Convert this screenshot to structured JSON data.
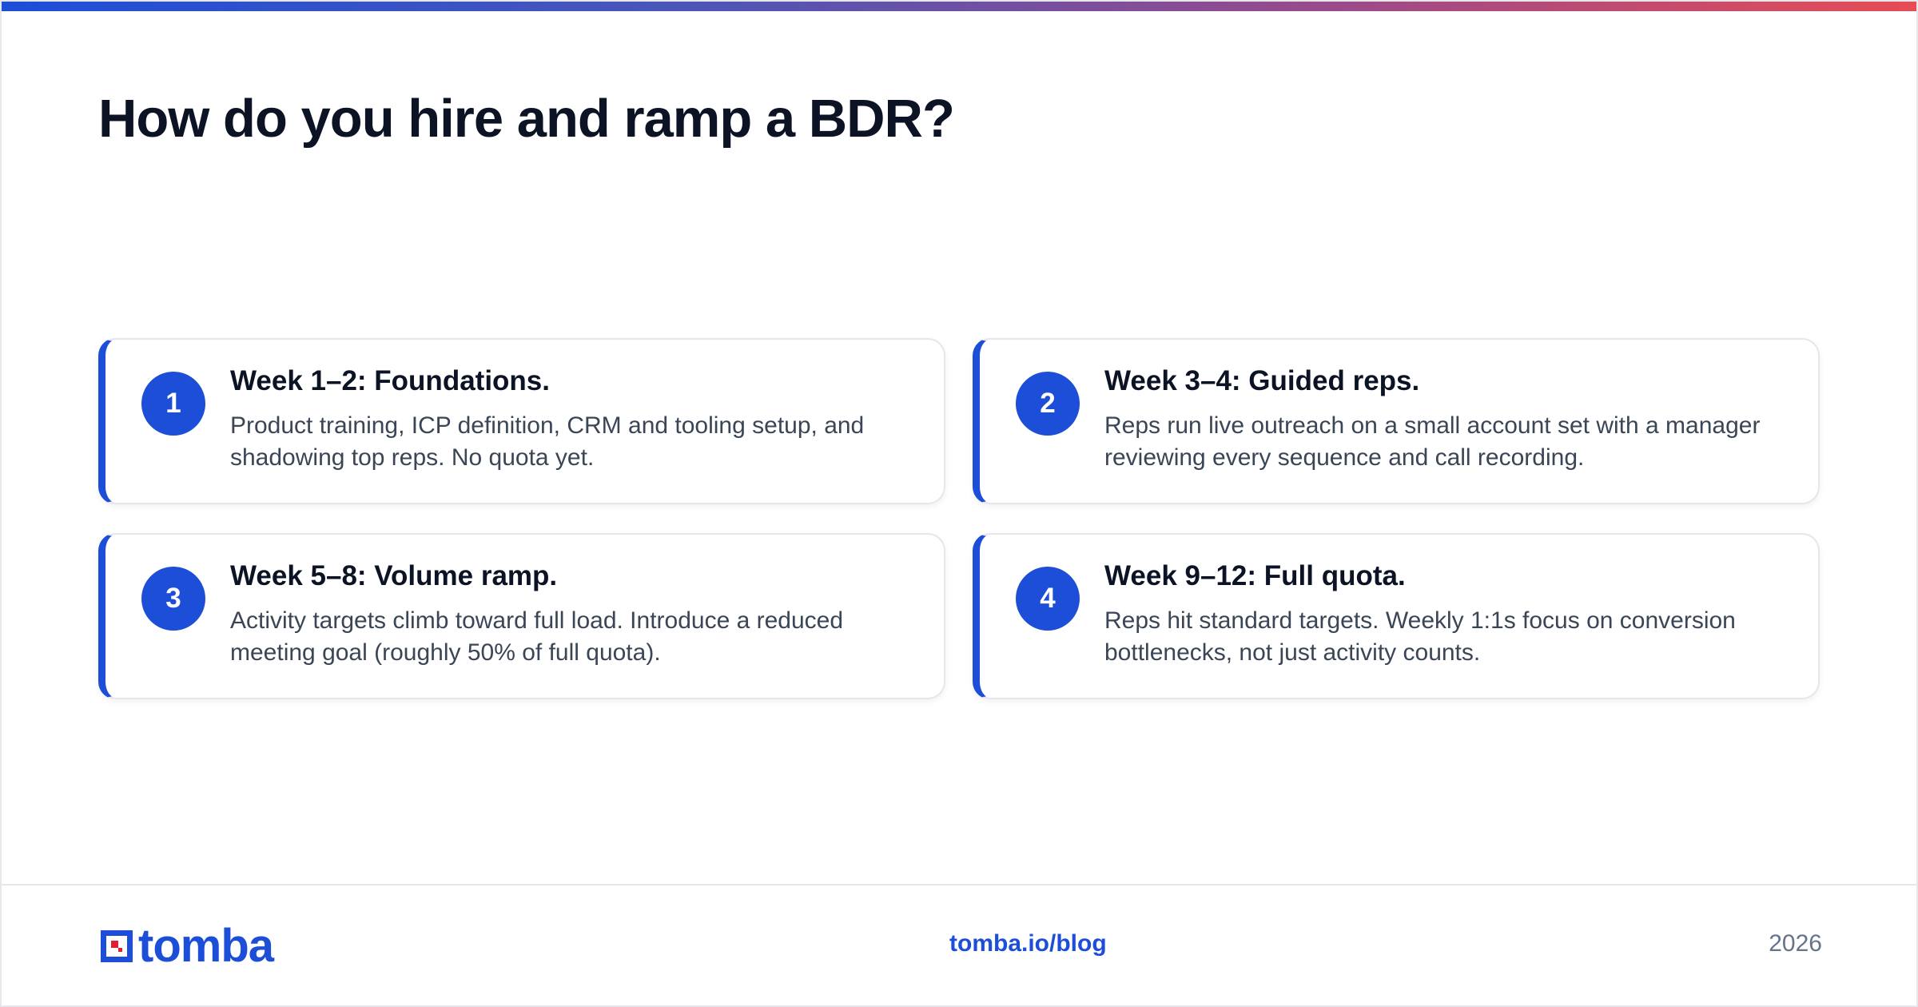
{
  "header": {
    "title": "How do you hire and ramp a BDR?"
  },
  "steps": [
    {
      "number": "1",
      "title": "Week 1–2: Foundations.",
      "description": "Product training, ICP definition, CRM and tooling setup, and shadowing top reps. No quota yet."
    },
    {
      "number": "2",
      "title": "Week 3–4: Guided reps.",
      "description": "Reps run live outreach on a small account set with a manager reviewing every sequence and call recording."
    },
    {
      "number": "3",
      "title": "Week 5–8: Volume ramp.",
      "description": "Activity targets climb toward full load. Introduce a reduced meeting goal (roughly 50% of full quota)."
    },
    {
      "number": "4",
      "title": "Week 9–12: Full quota.",
      "description": "Reps hit standard targets. Weekly 1:1s focus on conversion bottlenecks, not just activity counts."
    }
  ],
  "footer": {
    "logo_text": "tomba",
    "link": "tomba.io/blog",
    "year": "2026"
  },
  "colors": {
    "accent": "#1d4ed8",
    "logo_red": "#e11d2f",
    "gradient_start": "#1d4ed8",
    "gradient_end": "#e64c55"
  },
  "icons": {
    "logo_mark": "tomba-logo-icon"
  }
}
